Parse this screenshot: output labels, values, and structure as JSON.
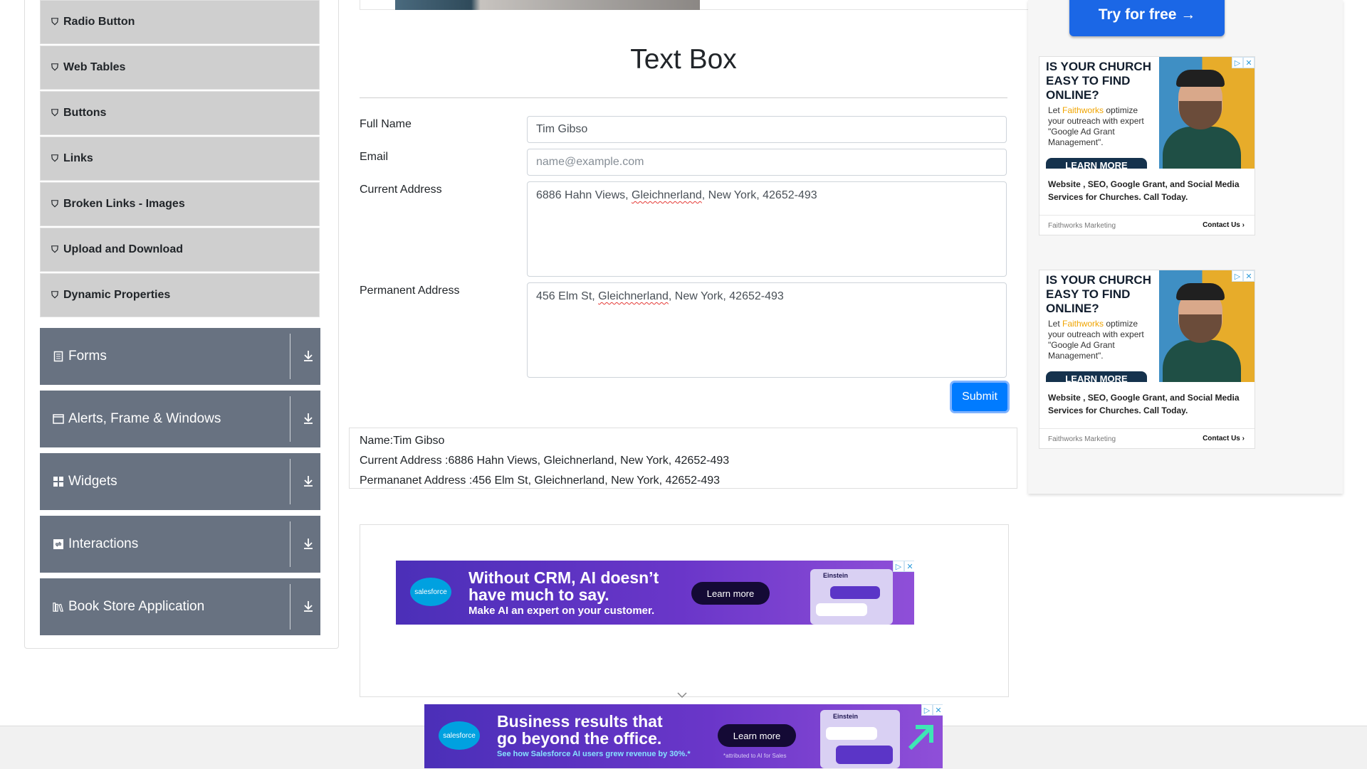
{
  "sidebar": {
    "items": [
      {
        "label": "Radio Button"
      },
      {
        "label": "Web Tables"
      },
      {
        "label": "Buttons"
      },
      {
        "label": "Links"
      },
      {
        "label": "Broken Links - Images"
      },
      {
        "label": "Upload and Download"
      },
      {
        "label": "Dynamic Properties"
      }
    ],
    "groups": [
      {
        "label": "Forms",
        "icon": "document-icon"
      },
      {
        "label": "Alerts, Frame & Windows",
        "icon": "window-icon"
      },
      {
        "label": "Widgets",
        "icon": "grid-icon"
      },
      {
        "label": "Interactions",
        "icon": "interact-icon"
      },
      {
        "label": "Book Store Application",
        "icon": "books-icon"
      }
    ]
  },
  "main": {
    "title": "Text Box",
    "form": {
      "full_name_label": "Full Name",
      "full_name_value": "Tim Gibso",
      "email_label": "Email",
      "email_placeholder": "name@example.com",
      "current_address_label": "Current Address",
      "current_address_pre": "6886 Hahn Views, ",
      "current_address_word": "Gleichnerland",
      "current_address_post": ", New York, 42652-493",
      "permanent_address_label": "Permanent Address",
      "permanent_address_pre": "456 Elm St, ",
      "permanent_address_word": "Gleichnerland",
      "permanent_address_post": ", New York, 42652-493",
      "submit_label": "Submit"
    },
    "output": {
      "name": "Name:Tim Gibso",
      "current_address": "Current Address :6886 Hahn Views, Gleichnerland, New York, 42652-493",
      "permanent_address": "Permananet Address :456 Elm St, Gleichnerland, New York, 42652-493"
    }
  },
  "ads": {
    "try_free": "Try for free →",
    "faithworks": {
      "headline": "IS YOUR CHURCH EASY TO FIND ONLINE?",
      "body_pre": "Let ",
      "body_brand": "Faithworks",
      "body_post": " optimize your outreach with expert \"Google Ad Grant Management\".",
      "learn_more": "LEARN MORE",
      "description": "Website , SEO, Google Grant, and Social Media Services for Churches. Call Today.",
      "brand": "Faithworks Marketing",
      "contact": "Contact Us"
    },
    "salesforce1": {
      "logo": "salesforce",
      "line1": "Without CRM, AI doesn’t",
      "line2": "have much to say.",
      "sub": "Make AI an expert on your customer.",
      "cta": "Learn more",
      "card_title": "Einstein"
    },
    "salesforce2": {
      "logo": "salesforce",
      "line1": "Business results that",
      "line2": "go beyond the office.",
      "sub": "See how Salesforce AI users grew revenue by 30%.*",
      "footnote": "*attributed to AI for Sales",
      "cta": "Learn more",
      "card_title": "Einstein"
    }
  }
}
